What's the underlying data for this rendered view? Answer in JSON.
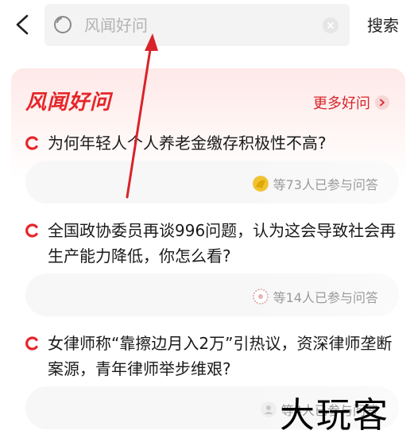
{
  "header": {
    "search_placeholder": "风闻好问",
    "search_button": "搜索"
  },
  "section": {
    "brand": "风闻好问",
    "more_label": "更多好问"
  },
  "questions": [
    {
      "title": "为何年轻人个人养老金缴存积极性不高?",
      "participants": "等73人已参与问答"
    },
    {
      "title": "全国政协委员再谈996问题，认为这会导致社会再生产能力降低，你怎么看?",
      "participants": "等14人已参与问答"
    },
    {
      "title": "女律师称“靠擦边月入2万”引热议，资深律师垄断案源，青年律师举步维艰?",
      "participants": "等4人已参与问答"
    }
  ],
  "watermark": "大玩客",
  "colors": {
    "brand_red": "#e5262a",
    "accent": "#d9262b",
    "annotation_arrow": "#d8232a"
  },
  "icons": {
    "back": "chevron-left-icon",
    "search": "search-icon",
    "clear": "close-icon",
    "more": "chevron-right-icon",
    "question": "c-logo-icon"
  }
}
